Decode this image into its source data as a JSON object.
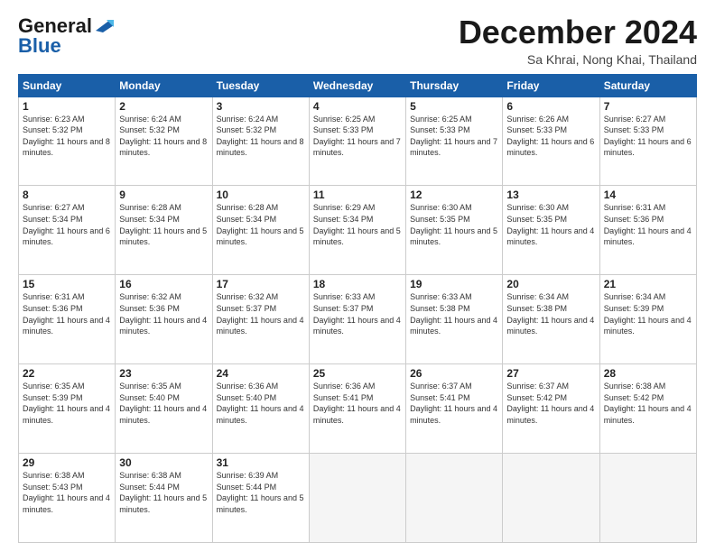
{
  "logo": {
    "line1": "General",
    "line2": "Blue"
  },
  "header": {
    "month": "December 2024",
    "location": "Sa Khrai, Nong Khai, Thailand"
  },
  "weekdays": [
    "Sunday",
    "Monday",
    "Tuesday",
    "Wednesday",
    "Thursday",
    "Friday",
    "Saturday"
  ],
  "weeks": [
    [
      {
        "day": "1",
        "sunrise": "6:23 AM",
        "sunset": "5:32 PM",
        "daylight": "11 hours and 8 minutes."
      },
      {
        "day": "2",
        "sunrise": "6:24 AM",
        "sunset": "5:32 PM",
        "daylight": "11 hours and 8 minutes."
      },
      {
        "day": "3",
        "sunrise": "6:24 AM",
        "sunset": "5:32 PM",
        "daylight": "11 hours and 8 minutes."
      },
      {
        "day": "4",
        "sunrise": "6:25 AM",
        "sunset": "5:33 PM",
        "daylight": "11 hours and 7 minutes."
      },
      {
        "day": "5",
        "sunrise": "6:25 AM",
        "sunset": "5:33 PM",
        "daylight": "11 hours and 7 minutes."
      },
      {
        "day": "6",
        "sunrise": "6:26 AM",
        "sunset": "5:33 PM",
        "daylight": "11 hours and 6 minutes."
      },
      {
        "day": "7",
        "sunrise": "6:27 AM",
        "sunset": "5:33 PM",
        "daylight": "11 hours and 6 minutes."
      }
    ],
    [
      {
        "day": "8",
        "sunrise": "6:27 AM",
        "sunset": "5:34 PM",
        "daylight": "11 hours and 6 minutes."
      },
      {
        "day": "9",
        "sunrise": "6:28 AM",
        "sunset": "5:34 PM",
        "daylight": "11 hours and 5 minutes."
      },
      {
        "day": "10",
        "sunrise": "6:28 AM",
        "sunset": "5:34 PM",
        "daylight": "11 hours and 5 minutes."
      },
      {
        "day": "11",
        "sunrise": "6:29 AM",
        "sunset": "5:34 PM",
        "daylight": "11 hours and 5 minutes."
      },
      {
        "day": "12",
        "sunrise": "6:30 AM",
        "sunset": "5:35 PM",
        "daylight": "11 hours and 5 minutes."
      },
      {
        "day": "13",
        "sunrise": "6:30 AM",
        "sunset": "5:35 PM",
        "daylight": "11 hours and 4 minutes."
      },
      {
        "day": "14",
        "sunrise": "6:31 AM",
        "sunset": "5:36 PM",
        "daylight": "11 hours and 4 minutes."
      }
    ],
    [
      {
        "day": "15",
        "sunrise": "6:31 AM",
        "sunset": "5:36 PM",
        "daylight": "11 hours and 4 minutes."
      },
      {
        "day": "16",
        "sunrise": "6:32 AM",
        "sunset": "5:36 PM",
        "daylight": "11 hours and 4 minutes."
      },
      {
        "day": "17",
        "sunrise": "6:32 AM",
        "sunset": "5:37 PM",
        "daylight": "11 hours and 4 minutes."
      },
      {
        "day": "18",
        "sunrise": "6:33 AM",
        "sunset": "5:37 PM",
        "daylight": "11 hours and 4 minutes."
      },
      {
        "day": "19",
        "sunrise": "6:33 AM",
        "sunset": "5:38 PM",
        "daylight": "11 hours and 4 minutes."
      },
      {
        "day": "20",
        "sunrise": "6:34 AM",
        "sunset": "5:38 PM",
        "daylight": "11 hours and 4 minutes."
      },
      {
        "day": "21",
        "sunrise": "6:34 AM",
        "sunset": "5:39 PM",
        "daylight": "11 hours and 4 minutes."
      }
    ],
    [
      {
        "day": "22",
        "sunrise": "6:35 AM",
        "sunset": "5:39 PM",
        "daylight": "11 hours and 4 minutes."
      },
      {
        "day": "23",
        "sunrise": "6:35 AM",
        "sunset": "5:40 PM",
        "daylight": "11 hours and 4 minutes."
      },
      {
        "day": "24",
        "sunrise": "6:36 AM",
        "sunset": "5:40 PM",
        "daylight": "11 hours and 4 minutes."
      },
      {
        "day": "25",
        "sunrise": "6:36 AM",
        "sunset": "5:41 PM",
        "daylight": "11 hours and 4 minutes."
      },
      {
        "day": "26",
        "sunrise": "6:37 AM",
        "sunset": "5:41 PM",
        "daylight": "11 hours and 4 minutes."
      },
      {
        "day": "27",
        "sunrise": "6:37 AM",
        "sunset": "5:42 PM",
        "daylight": "11 hours and 4 minutes."
      },
      {
        "day": "28",
        "sunrise": "6:38 AM",
        "sunset": "5:42 PM",
        "daylight": "11 hours and 4 minutes."
      }
    ],
    [
      {
        "day": "29",
        "sunrise": "6:38 AM",
        "sunset": "5:43 PM",
        "daylight": "11 hours and 4 minutes."
      },
      {
        "day": "30",
        "sunrise": "6:38 AM",
        "sunset": "5:44 PM",
        "daylight": "11 hours and 5 minutes."
      },
      {
        "day": "31",
        "sunrise": "6:39 AM",
        "sunset": "5:44 PM",
        "daylight": "11 hours and 5 minutes."
      },
      null,
      null,
      null,
      null
    ]
  ],
  "labels": {
    "sunrise": "Sunrise:",
    "sunset": "Sunset:",
    "daylight": "Daylight:"
  }
}
